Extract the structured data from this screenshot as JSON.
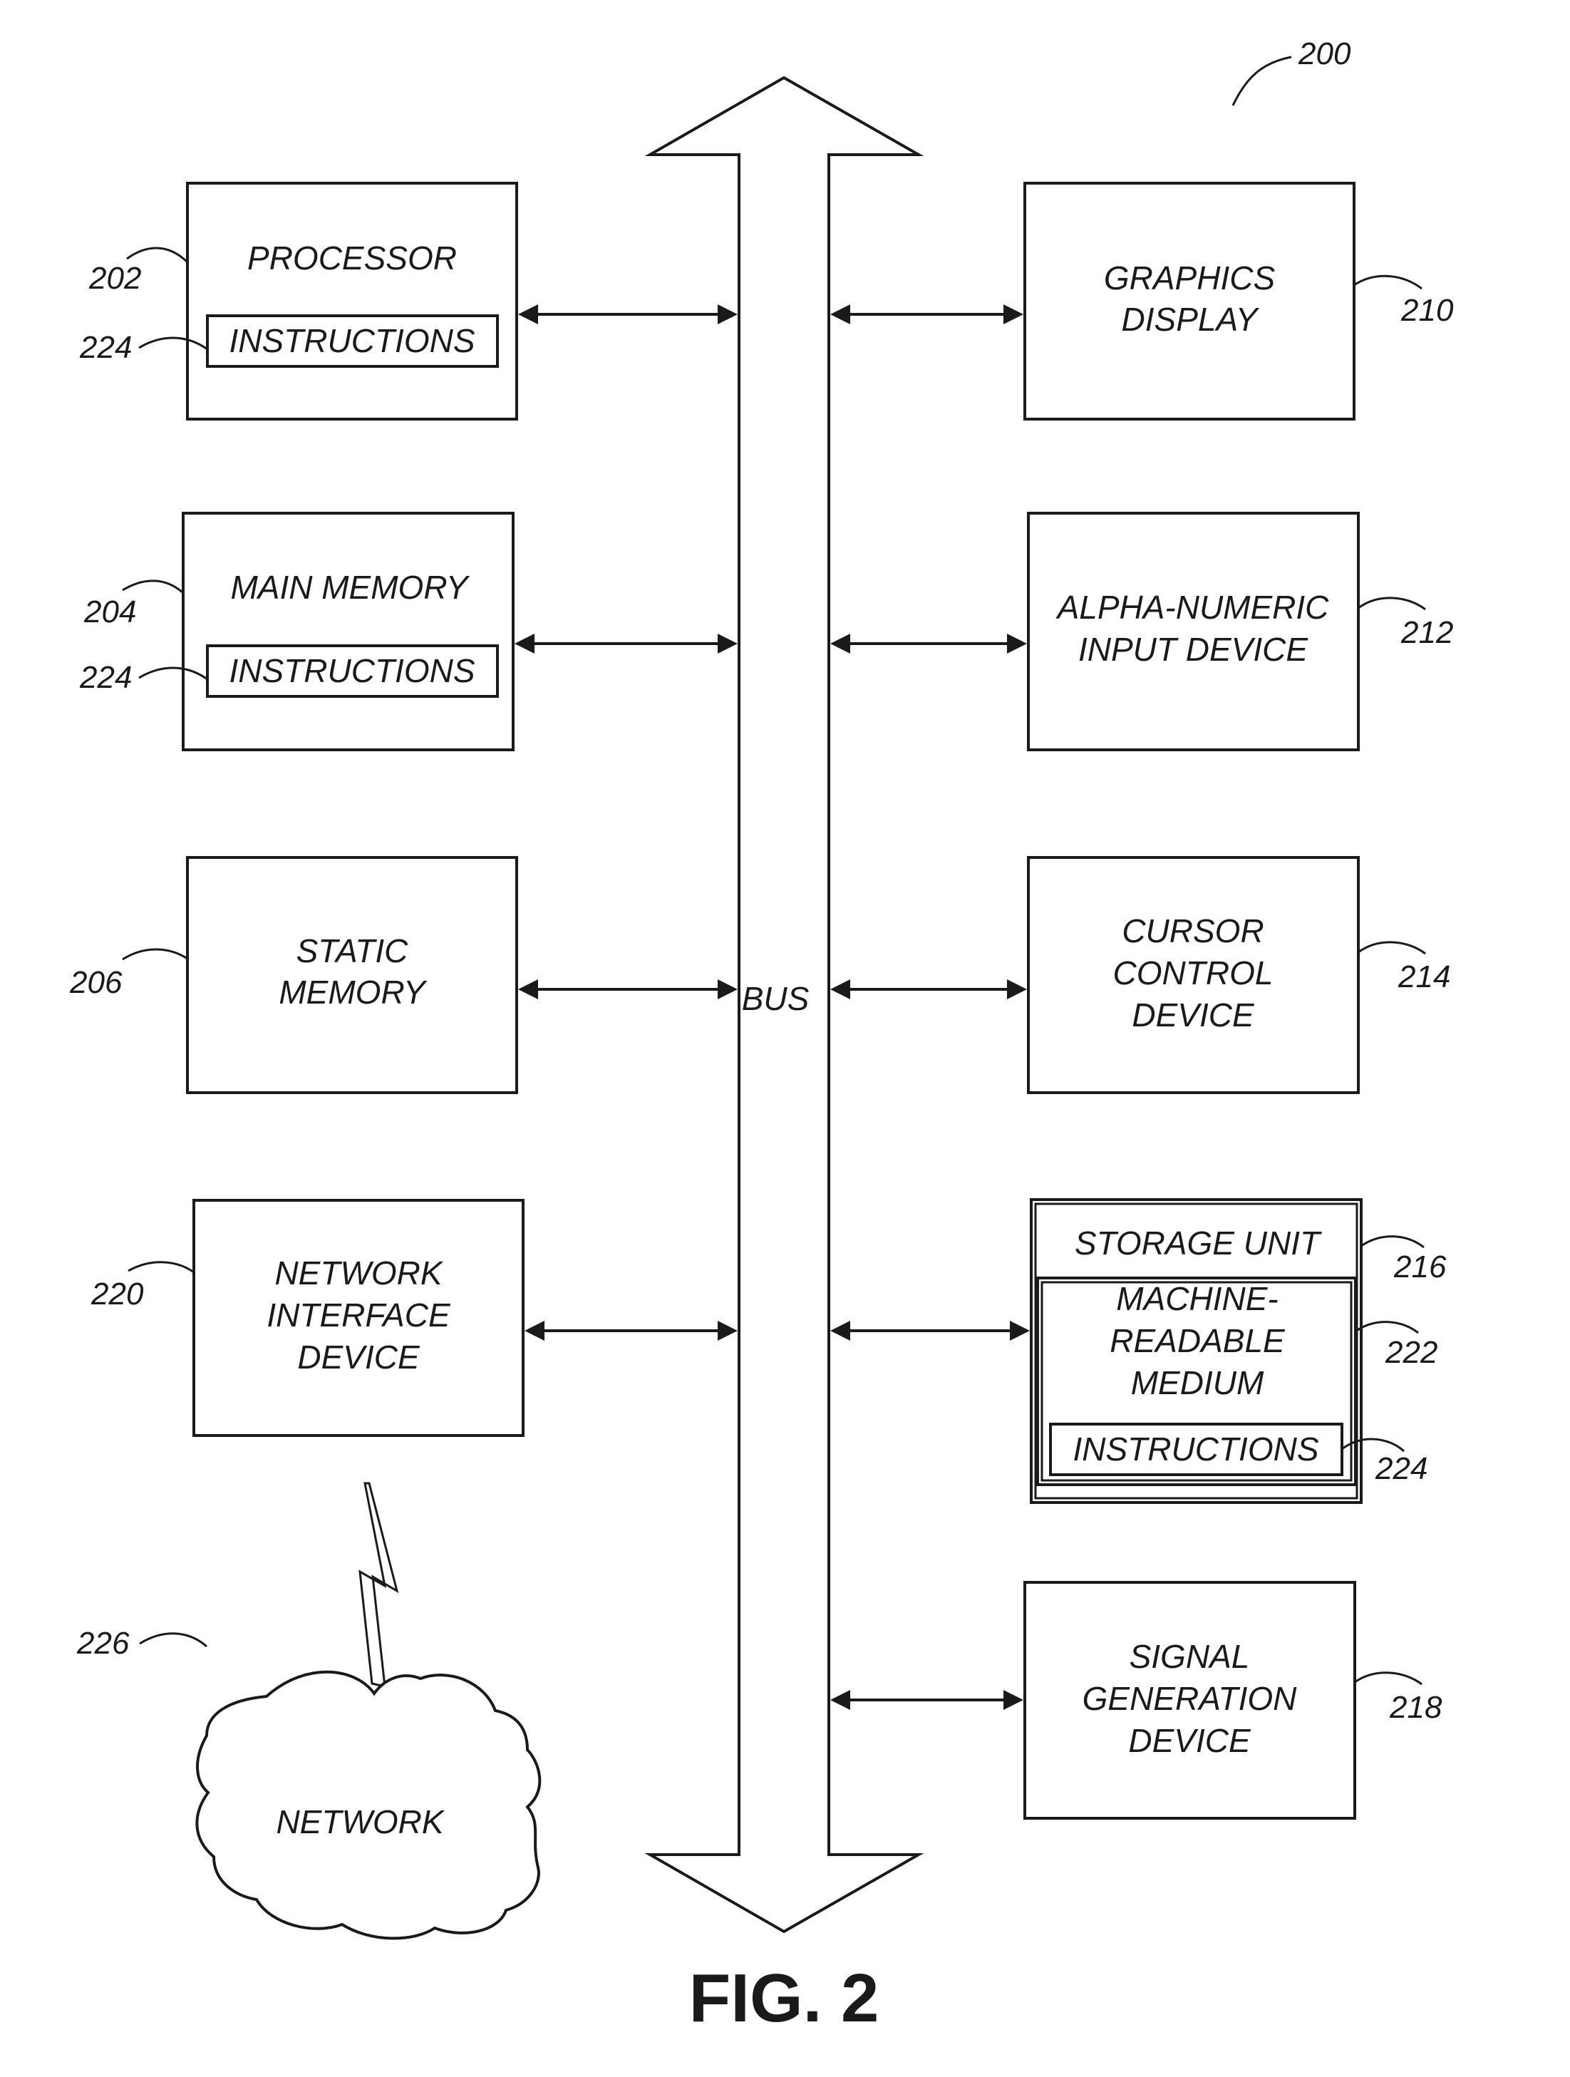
{
  "figure": {
    "label": "FIG. 2",
    "reference": "200"
  },
  "bus": {
    "label": "BUS"
  },
  "components": {
    "processor": {
      "ref": "202",
      "lines": [
        "PROCESSOR"
      ],
      "instructions": {
        "ref": "224",
        "label": "INSTRUCTIONS"
      }
    },
    "main_memory": {
      "ref": "204",
      "lines": [
        "MAIN MEMORY"
      ],
      "instructions": {
        "ref": "224",
        "label": "INSTRUCTIONS"
      }
    },
    "static_memory": {
      "ref": "206",
      "lines": [
        "STATIC",
        "MEMORY"
      ]
    },
    "network_interface": {
      "ref": "220",
      "lines": [
        "NETWORK",
        "INTERFACE",
        "DEVICE"
      ]
    },
    "network": {
      "ref": "226",
      "label": "NETWORK"
    },
    "graphics_display": {
      "ref": "210",
      "lines": [
        "GRAPHICS",
        "DISPLAY"
      ]
    },
    "alpha_numeric": {
      "ref": "212",
      "lines": [
        "ALPHA-NUMERIC",
        "INPUT DEVICE"
      ]
    },
    "cursor_control": {
      "ref": "214",
      "lines": [
        "CURSOR",
        "CONTROL",
        "DEVICE"
      ]
    },
    "storage_unit": {
      "ref": "216",
      "label": "STORAGE UNIT",
      "medium": {
        "ref": "222",
        "lines": [
          "MACHINE-",
          "READABLE",
          "MEDIUM"
        ]
      },
      "instructions": {
        "ref": "224",
        "label": "INSTRUCTIONS"
      }
    },
    "signal_generation": {
      "ref": "218",
      "lines": [
        "SIGNAL",
        "GENERATION",
        "DEVICE"
      ]
    }
  }
}
